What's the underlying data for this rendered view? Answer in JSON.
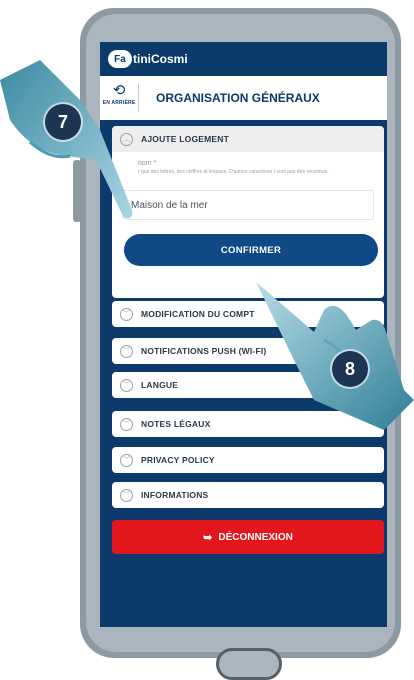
{
  "app": {
    "logo_badge": "Fa",
    "logo_rest": "tiniCosmi"
  },
  "title_bar": {
    "back_glyph": "⟲",
    "back_label": "EN ARRIÈRE",
    "title": "ORGANISATION GÉNÉRAUX"
  },
  "add_home": {
    "header": "AJOUTE LOGEMENT",
    "field_label": "nom *",
    "field_hint": "r que des lettres, des chiffres et lespace. D'autres caractères t sont pas être reconnus.",
    "input_value": "Maison de la mer",
    "confirm": "CONFIRMER"
  },
  "menu": [
    "MODIFICATION DU COMPT",
    "NOTIFICATIONS PUSH (WI-FI)",
    "LANGUE",
    "NOTES LÉGAUX",
    "PRIVACY POLICY",
    "INFORMATIONS"
  ],
  "logout": "DÉCONNEXION",
  "steps": {
    "first": "7",
    "second": "8"
  },
  "colors": {
    "app_blue": "#0c3a6b",
    "button_blue": "#0f4a86",
    "logout_red": "#e4161d",
    "hand": "#7fb7c9"
  }
}
